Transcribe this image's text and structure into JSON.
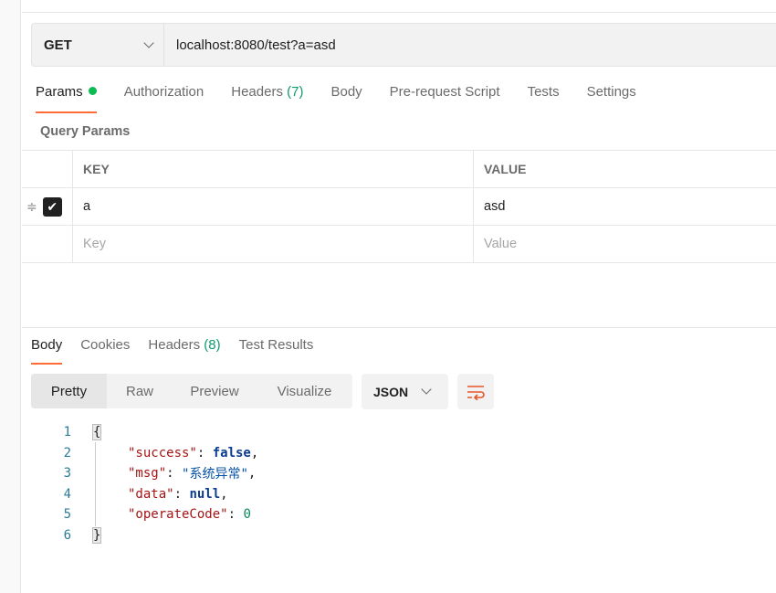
{
  "request": {
    "method": "GET",
    "url": "localhost:8080/test?a=asd"
  },
  "request_tabs": [
    {
      "label": "Params",
      "active": true
    },
    {
      "label": "Authorization"
    },
    {
      "label": "Headers",
      "count": "(7)"
    },
    {
      "label": "Body"
    },
    {
      "label": "Pre-request Script"
    },
    {
      "label": "Tests"
    },
    {
      "label": "Settings"
    }
  ],
  "query_params": {
    "title": "Query Params",
    "headers": [
      "KEY",
      "VALUE"
    ],
    "rows": [
      {
        "checked": true,
        "key": "a",
        "value": "asd"
      }
    ],
    "placeholder": {
      "key": "Key",
      "value": "Value"
    }
  },
  "response_tabs": [
    {
      "label": "Body",
      "active": true
    },
    {
      "label": "Cookies"
    },
    {
      "label": "Headers",
      "count": "(8)"
    },
    {
      "label": "Test Results"
    }
  ],
  "view_modes": [
    "Pretty",
    "Raw",
    "Preview",
    "Visualize"
  ],
  "format": "JSON",
  "colors": {
    "accent": "#ff6c37",
    "dot": "#0cbb52"
  },
  "body_lines": [
    {
      "n": "1",
      "text": "{"
    },
    {
      "n": "2",
      "key": "\"success\"",
      "val": "false",
      "sep": ","
    },
    {
      "n": "3",
      "key": "\"msg\"",
      "val": "\"系统异常\"",
      "sep": ","
    },
    {
      "n": "4",
      "key": "\"data\"",
      "val": "null",
      "sep": ","
    },
    {
      "n": "5",
      "key": "\"operateCode\"",
      "val": "0",
      "sep": ""
    },
    {
      "n": "6",
      "text": "}"
    }
  ]
}
